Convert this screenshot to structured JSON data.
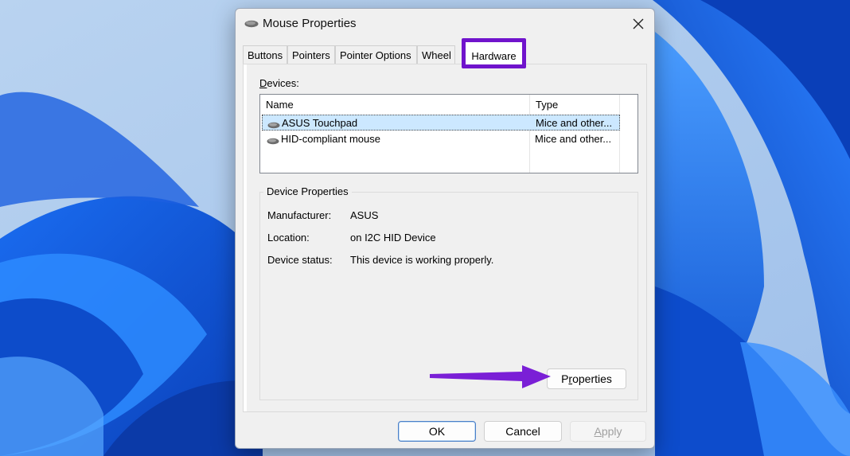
{
  "window": {
    "title": "Mouse Properties"
  },
  "tabs": [
    "Buttons",
    "Pointers",
    "Pointer Options",
    "Wheel",
    "Hardware"
  ],
  "hardware": {
    "devices_label_prefix": "D",
    "devices_label_rest": "evices:",
    "columns": {
      "name": "Name",
      "type": "Type"
    },
    "devices": [
      {
        "name": "ASUS Touchpad",
        "type": "Mice and other...",
        "selected": true
      },
      {
        "name": "HID-compliant mouse",
        "type": "Mice and other...",
        "selected": false
      }
    ],
    "device_properties": {
      "title": "Device Properties",
      "manufacturer_label": "Manufacturer:",
      "manufacturer": "ASUS",
      "location_label": "Location:",
      "location": "on I2C HID Device",
      "status_label": "Device status:",
      "status": "This device is working properly."
    },
    "properties_button": {
      "prefix": "P",
      "underlined": "r",
      "rest": "operties"
    }
  },
  "footer": {
    "ok": "OK",
    "cancel": "Cancel",
    "apply_underlined": "A",
    "apply_rest": "pply"
  },
  "colors": {
    "highlight": "#7014cc",
    "selection": "#cce8ff",
    "arrow": "#7a1fd6"
  },
  "icons": [
    "mouse-icon",
    "close-icon",
    "arrow-annotation"
  ]
}
